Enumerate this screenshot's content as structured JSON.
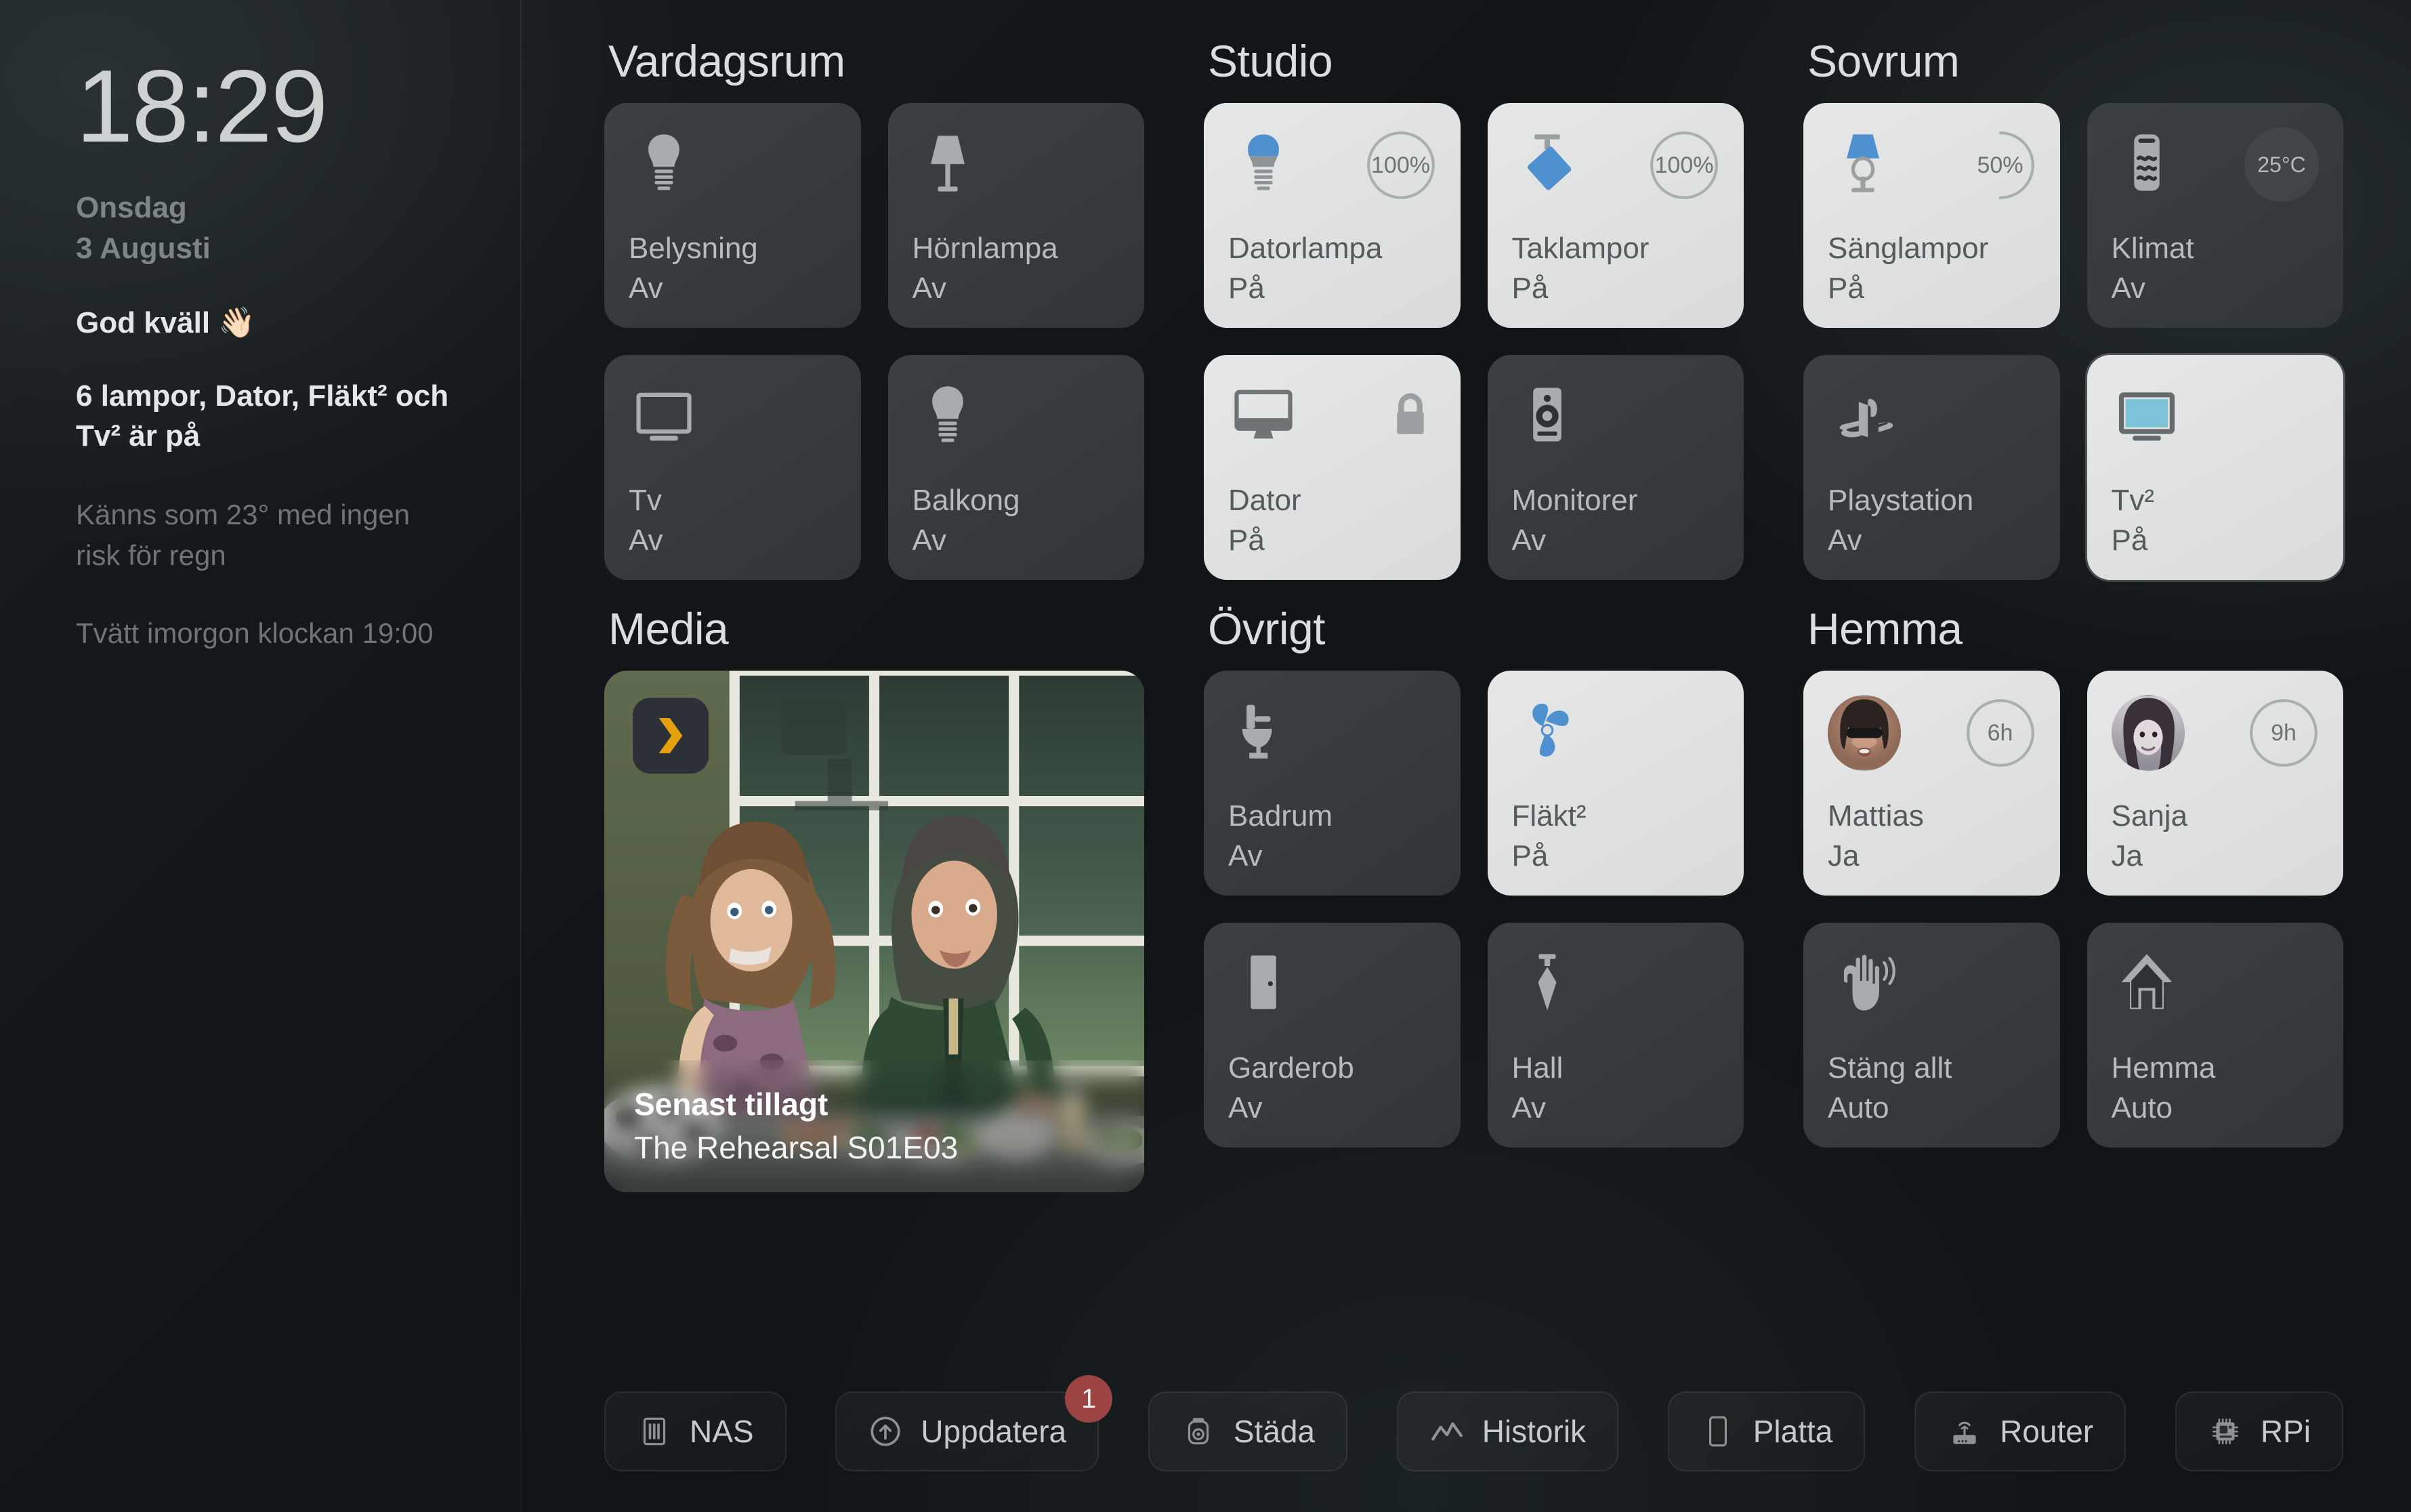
{
  "sidebar": {
    "time": "18:29",
    "weekday": "Onsdag",
    "date": "3 Augusti",
    "greeting": "God kväll 👋🏻",
    "summary": "6 lampor, Dator, Fläkt² och Tv² är på",
    "weather": "Känns som 23° med ingen risk för regn",
    "laundry": "Tvätt imorgon klockan 19:00"
  },
  "zones": [
    {
      "title": "Vardagsrum",
      "tiles": [
        {
          "name": "Belysning",
          "state": "Av",
          "on": false,
          "icon": "bulb",
          "badge": null
        },
        {
          "name": "Hörnlampa",
          "state": "Av",
          "on": false,
          "icon": "lamp",
          "badge": null
        },
        {
          "name": "Tv",
          "state": "Av",
          "on": false,
          "icon": "tv",
          "badge": null
        },
        {
          "name": "Balkong",
          "state": "Av",
          "on": false,
          "icon": "bulb",
          "badge": null
        }
      ]
    },
    {
      "title": "Studio",
      "tiles": [
        {
          "name": "Datorlampa",
          "state": "På",
          "on": true,
          "icon": "bulb-blue",
          "badge": {
            "type": "ring",
            "value": "100%",
            "pct": 100
          }
        },
        {
          "name": "Taklampor",
          "state": "På",
          "on": true,
          "icon": "pendant-blue",
          "badge": {
            "type": "ring",
            "value": "100%",
            "pct": 100
          }
        },
        {
          "name": "Dator",
          "state": "På",
          "on": true,
          "icon": "monitor",
          "badge": {
            "type": "lock"
          }
        },
        {
          "name": "Monitorer",
          "state": "Av",
          "on": false,
          "icon": "speaker",
          "badge": null
        }
      ]
    },
    {
      "title": "Sovrum",
      "tiles": [
        {
          "name": "Sänglampor",
          "state": "På",
          "on": true,
          "icon": "table-lamp-blue",
          "badge": {
            "type": "ring",
            "value": "50%",
            "pct": 50
          }
        },
        {
          "name": "Klimat",
          "state": "Av",
          "on": false,
          "icon": "climate",
          "badge": {
            "type": "chip",
            "value": "25°C"
          }
        },
        {
          "name": "Playstation",
          "state": "Av",
          "on": false,
          "icon": "playstation",
          "badge": null
        },
        {
          "name": "Tv²",
          "state": "På",
          "on": true,
          "icon": "tv-blue",
          "badge": null,
          "highlight": true
        }
      ]
    },
    {
      "title": "Media",
      "media": {
        "logo": "plex-icon",
        "caption_title": "Senast tillagt",
        "caption_subtitle": "The Rehearsal S01E03"
      }
    },
    {
      "title": "Övrigt",
      "tiles": [
        {
          "name": "Badrum",
          "state": "Av",
          "on": false,
          "icon": "toilet",
          "badge": null
        },
        {
          "name": "Fläkt²",
          "state": "På",
          "on": true,
          "icon": "fan-blue",
          "badge": null
        },
        {
          "name": "Garderob",
          "state": "Av",
          "on": false,
          "icon": "door",
          "badge": null
        },
        {
          "name": "Hall",
          "state": "Av",
          "on": false,
          "icon": "tie-lamp",
          "badge": null
        }
      ]
    },
    {
      "title": "Hemma",
      "tiles": [
        {
          "name": "Mattias",
          "state": "Ja",
          "on": true,
          "icon": "avatar-mattias",
          "badge": {
            "type": "ring",
            "value": "6h",
            "pct": 100
          }
        },
        {
          "name": "Sanja",
          "state": "Ja",
          "on": true,
          "icon": "avatar-sanja",
          "badge": {
            "type": "ring",
            "value": "9h",
            "pct": 100
          }
        },
        {
          "name": "Stäng allt",
          "state": "Auto",
          "on": false,
          "icon": "wave-hand",
          "badge": null
        },
        {
          "name": "Hemma",
          "state": "Auto",
          "on": false,
          "icon": "house",
          "badge": null
        }
      ]
    }
  ],
  "toolbar": [
    {
      "label": "NAS",
      "icon": "nas-icon",
      "badge": null
    },
    {
      "label": "Uppdatera",
      "icon": "update-icon",
      "badge": "1"
    },
    {
      "label": "Städa",
      "icon": "vacuum-icon",
      "badge": null
    },
    {
      "label": "Historik",
      "icon": "history-icon",
      "badge": null
    },
    {
      "label": "Platta",
      "icon": "tablet-icon",
      "badge": null
    },
    {
      "label": "Router",
      "icon": "router-icon",
      "badge": null
    },
    {
      "label": "RPi",
      "icon": "chip-icon",
      "badge": null
    }
  ],
  "colors": {
    "accent_blue": "#4f90cf",
    "tv_screen": "#7cc3d8",
    "badge_red": "#9c4343",
    "tile_on": "#e1e2e2",
    "tile_off": "#383e40"
  }
}
